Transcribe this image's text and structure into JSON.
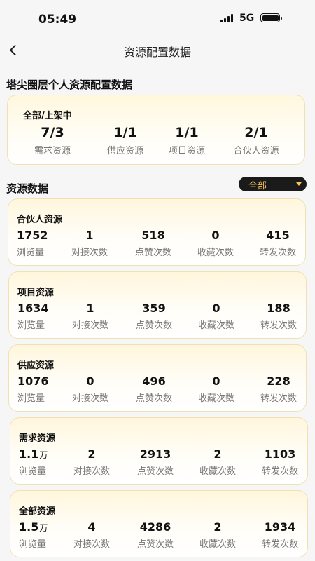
{
  "status_bar": {
    "time": "05:49",
    "network": "5G"
  },
  "nav": {
    "title": "资源配置数据"
  },
  "section1_title": "塔尖圈层个人资源配置数据",
  "summary": {
    "status": "全部/上架中",
    "items": [
      {
        "value": "7/3",
        "label": "需求资源"
      },
      {
        "value": "1/1",
        "label": "供应资源"
      },
      {
        "value": "1/1",
        "label": "项目资源"
      },
      {
        "value": "2/1",
        "label": "合伙人资源"
      }
    ]
  },
  "section2_title": "资源数据",
  "filter": {
    "selected": "全部"
  },
  "stat_labels": [
    "浏览量",
    "对接次数",
    "点赞次数",
    "收藏次数",
    "转发次数"
  ],
  "cards": [
    {
      "title": "合伙人资源",
      "views": "1752",
      "views_unit": "",
      "docking": "1",
      "likes": "518",
      "favorites": "0",
      "shares": "415"
    },
    {
      "title": "项目资源",
      "views": "1634",
      "views_unit": "",
      "docking": "1",
      "likes": "359",
      "favorites": "0",
      "shares": "188"
    },
    {
      "title": "供应资源",
      "views": "1076",
      "views_unit": "",
      "docking": "0",
      "likes": "496",
      "favorites": "0",
      "shares": "228"
    },
    {
      "title": "需求资源",
      "views": "1.1",
      "views_unit": "万",
      "docking": "2",
      "likes": "2913",
      "favorites": "2",
      "shares": "1103"
    },
    {
      "title": "全部资源",
      "views": "1.5",
      "views_unit": "万",
      "docking": "4",
      "likes": "4286",
      "favorites": "2",
      "shares": "1934"
    }
  ]
}
